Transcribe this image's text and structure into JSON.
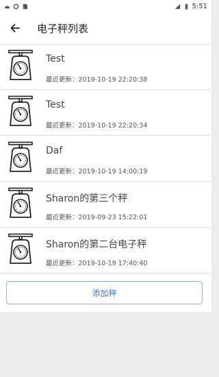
{
  "status_bar": {
    "time": "5:51",
    "icons": [
      "android-head-icon",
      "circle-icon",
      "sim-card-icon",
      "signal-icon",
      "battery-icon"
    ]
  },
  "app_bar": {
    "back_icon": "arrow-left-icon",
    "title": "电子秤列表"
  },
  "scales": [
    {
      "name": "Test",
      "update_label": "最近更新：",
      "update_time": "2019-10-19 22:20:38",
      "icon": "scale-icon"
    },
    {
      "name": "Test",
      "update_label": "最近更新：",
      "update_time": "2019-10-19 22:20:34",
      "icon": "scale-icon"
    },
    {
      "name": "Daf",
      "update_label": "最近更新：",
      "update_time": "2019-10-19 14:00:19",
      "icon": "scale-icon"
    },
    {
      "name": "Sharon的第三个秤",
      "update_label": "最近更新：",
      "update_time": "2019-09-23 15:22:01",
      "icon": "scale-icon"
    },
    {
      "name": "Sharon的第二台电子秤",
      "update_label": "最近更新：",
      "update_time": "2019-10-19 17:40:40",
      "icon": "scale-icon"
    }
  ],
  "add_button": {
    "label": "添加秤"
  },
  "colors": {
    "accent": "#3d7bd9",
    "background": "#ededed"
  }
}
